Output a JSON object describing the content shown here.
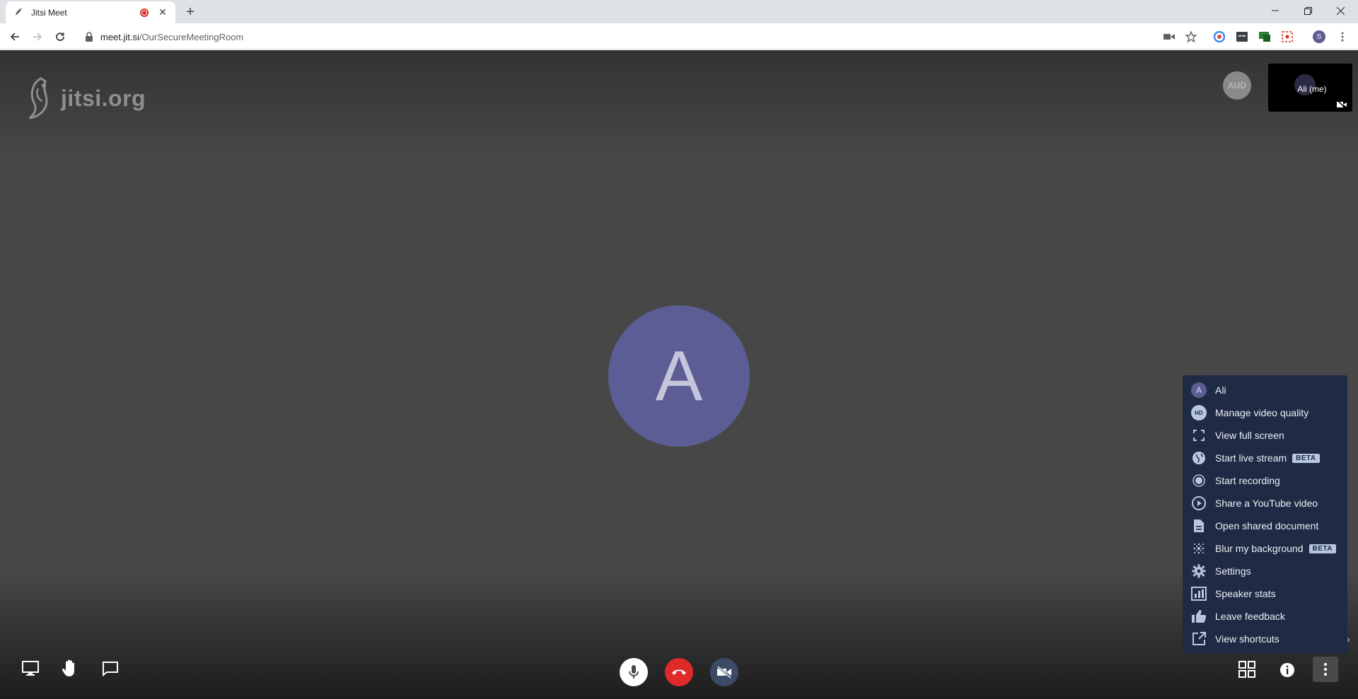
{
  "browser": {
    "tab_title": "Jitsi Meet",
    "new_tab": "+",
    "url_host": "meet.jit.si",
    "url_path": "/OurSecureMeetingRoom",
    "profile_initial": "S"
  },
  "meeting": {
    "watermark": "jitsi.org",
    "speaker_initial": "A",
    "audio_badge": "AUD",
    "self_label": "Ali (me)",
    "avatar_color": "#5c5d94"
  },
  "menu": {
    "items": [
      {
        "label": "Ali",
        "icon": "A"
      },
      {
        "label": "Manage video quality",
        "icon": "HD"
      },
      {
        "label": "View full screen",
        "icon": "fullscreen-icon"
      },
      {
        "label": "Start live stream",
        "icon": "live-stream-icon",
        "badge": "BETA"
      },
      {
        "label": "Start recording",
        "icon": "record-icon"
      },
      {
        "label": "Share a YouTube video",
        "icon": "play-icon"
      },
      {
        "label": "Open shared document",
        "icon": "document-icon"
      },
      {
        "label": "Blur my background",
        "icon": "blur-icon",
        "badge": "BETA"
      },
      {
        "label": "Settings",
        "icon": "gear-icon"
      },
      {
        "label": "Speaker stats",
        "icon": "stats-icon"
      },
      {
        "label": "Leave feedback",
        "icon": "thumbs-up-icon"
      },
      {
        "label": "View shortcuts",
        "icon": "external-link-icon"
      }
    ]
  },
  "colors": {
    "stage": "#474747",
    "menu_bg": "#1f2a44",
    "hangup": "#e02a2a"
  }
}
